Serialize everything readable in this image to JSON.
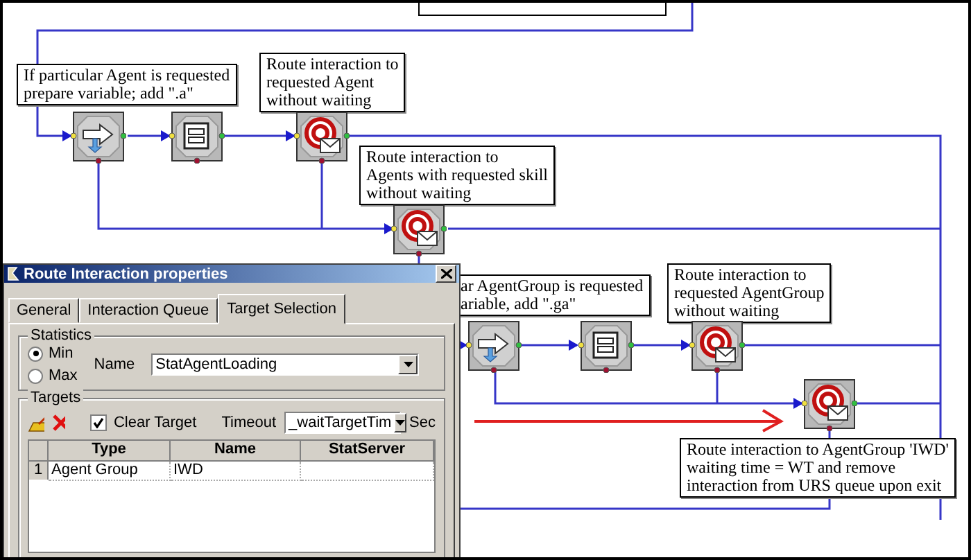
{
  "notes": [
    {
      "lines": [
        "If particular Agent is requested",
        "prepare variable; add \".a\""
      ]
    },
    {
      "lines": [
        "Route interaction to",
        "requested Agent",
        "without waiting"
      ]
    },
    {
      "lines": [
        "Route interaction to",
        "Agents with requested skill",
        "without waiting"
      ]
    },
    {
      "lines": [
        "ar AgentGroup is requested",
        "ariable, add \".ga\""
      ]
    },
    {
      "lines": [
        "Route interaction to",
        "requested AgentGroup",
        "without waiting"
      ]
    },
    {
      "lines": [
        "Route interaction to AgentGroup 'IWD'",
        "waiting time = WT and remove",
        "interaction from URS queue upon exit"
      ]
    }
  ],
  "nodes": [
    {
      "kind": "branch"
    },
    {
      "kind": "list"
    },
    {
      "kind": "route"
    },
    {
      "kind": "route"
    },
    {
      "kind": "branch"
    },
    {
      "kind": "list"
    },
    {
      "kind": "route"
    },
    {
      "kind": "route"
    }
  ],
  "dialog": {
    "title": "Route Interaction properties",
    "tabs": [
      {
        "label": "General",
        "selected": false
      },
      {
        "label": "Interaction Queue",
        "selected": false
      },
      {
        "label": "Target Selection",
        "selected": true
      }
    ],
    "statistics": {
      "legend": "Statistics",
      "options": [
        {
          "label": "Min",
          "selected": true
        },
        {
          "label": "Max",
          "selected": false
        }
      ],
      "name_label": "Name",
      "name_value": "StatAgentLoading"
    },
    "targets": {
      "legend": "Targets",
      "clear_target": {
        "label": "Clear Target",
        "checked": true
      },
      "timeout_label": "Timeout",
      "timeout_value": "_waitTargetTim",
      "unit": "Sec",
      "table": {
        "columns": [
          "Type",
          "Name",
          "StatServer"
        ],
        "rows": [
          {
            "index": "1",
            "cells": [
              "Agent Group",
              "IWD"
            ]
          }
        ]
      }
    }
  }
}
